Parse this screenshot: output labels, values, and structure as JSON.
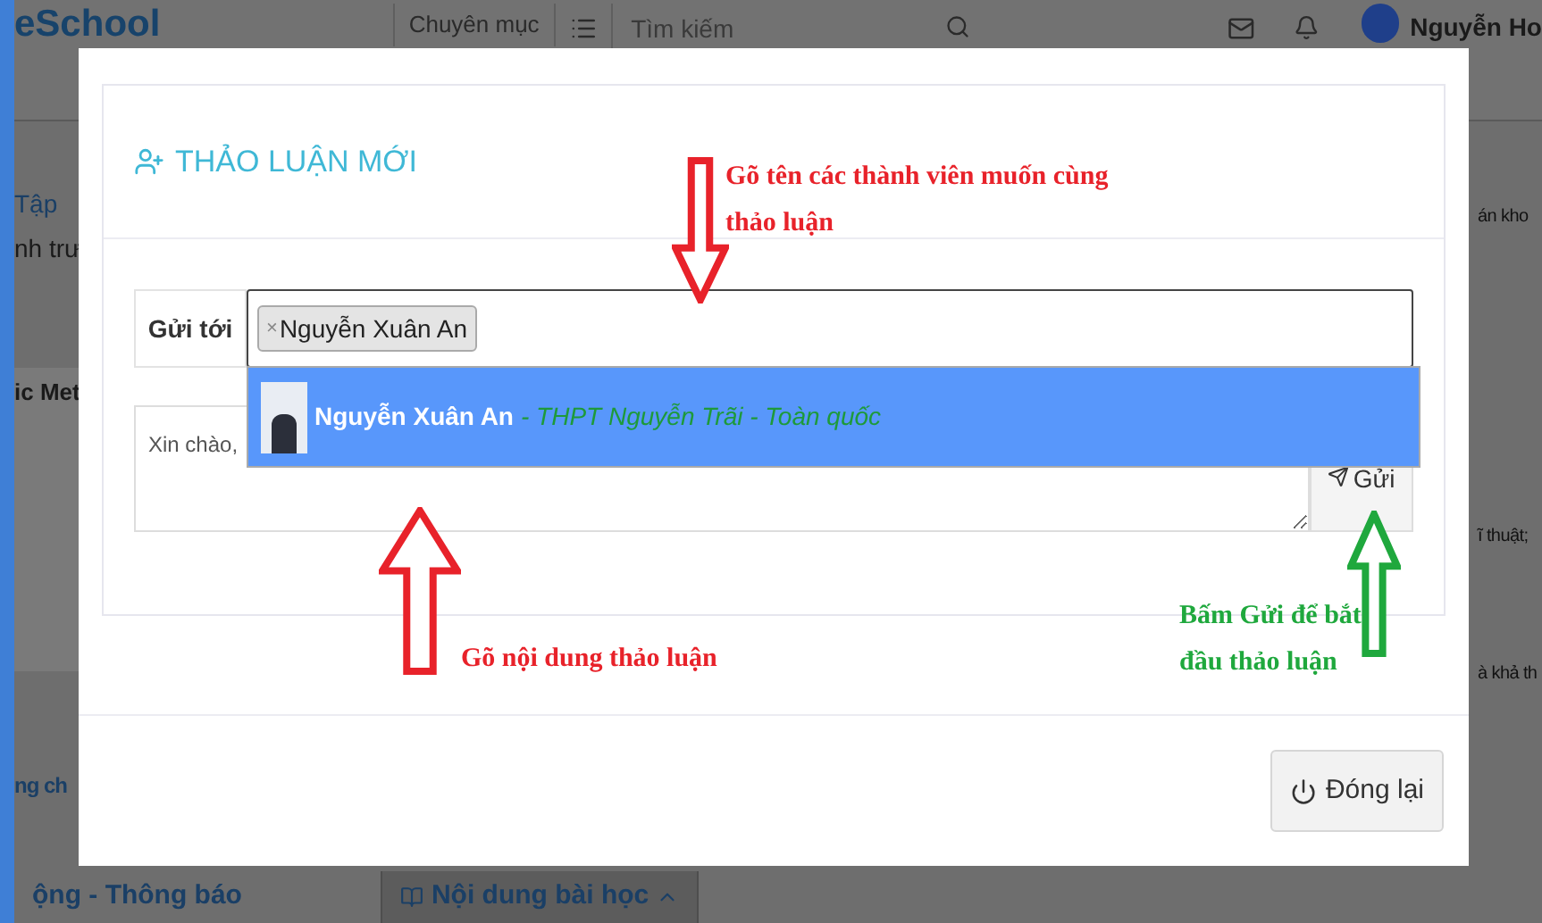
{
  "background": {
    "logo": "eSchool",
    "menu": "Chuyên mục",
    "search_placeholder": "Tìm kiếm",
    "user_name": "Nguyễn Ho",
    "left_fragments": [
      "Tập",
      "nh trư"
    ],
    "image_caption": "ic Met",
    "left_heading": "ng ch",
    "right_fragments": [
      "án kho",
      "ĩ thuật;",
      "à khả th"
    ],
    "bottom_tabs": [
      {
        "label": "ộng - Thông báo",
        "selected": false
      },
      {
        "label": "Nội dung bài học",
        "selected": true
      }
    ]
  },
  "modal": {
    "title": "THẢO LUẬN MỚI",
    "to_label": "Gửi tới",
    "recipients": [
      "Nguyễn Xuân An"
    ],
    "remove_mark": "×",
    "message_placeholder": "Xin chào,",
    "send_button": "Gửi",
    "suggestion": {
      "name": "Nguyễn Xuân An",
      "detail": "- THPT Nguyễn Trãi - Toàn quốc",
      "selected": true
    },
    "close_button": "Đóng lại"
  },
  "annotations": [
    {
      "kind": "down",
      "color": "#e8222a",
      "lines": [
        "Gõ tên các thành viên muốn cùng",
        "thảo luận"
      ]
    },
    {
      "kind": "up",
      "color": "#e8222a",
      "lines": [
        "Gõ nội dung thảo luận"
      ]
    },
    {
      "kind": "up",
      "color": "#1fa83d",
      "lines": [
        "Bấm Gửi để bắt",
        "đầu thảo luận"
      ]
    }
  ]
}
